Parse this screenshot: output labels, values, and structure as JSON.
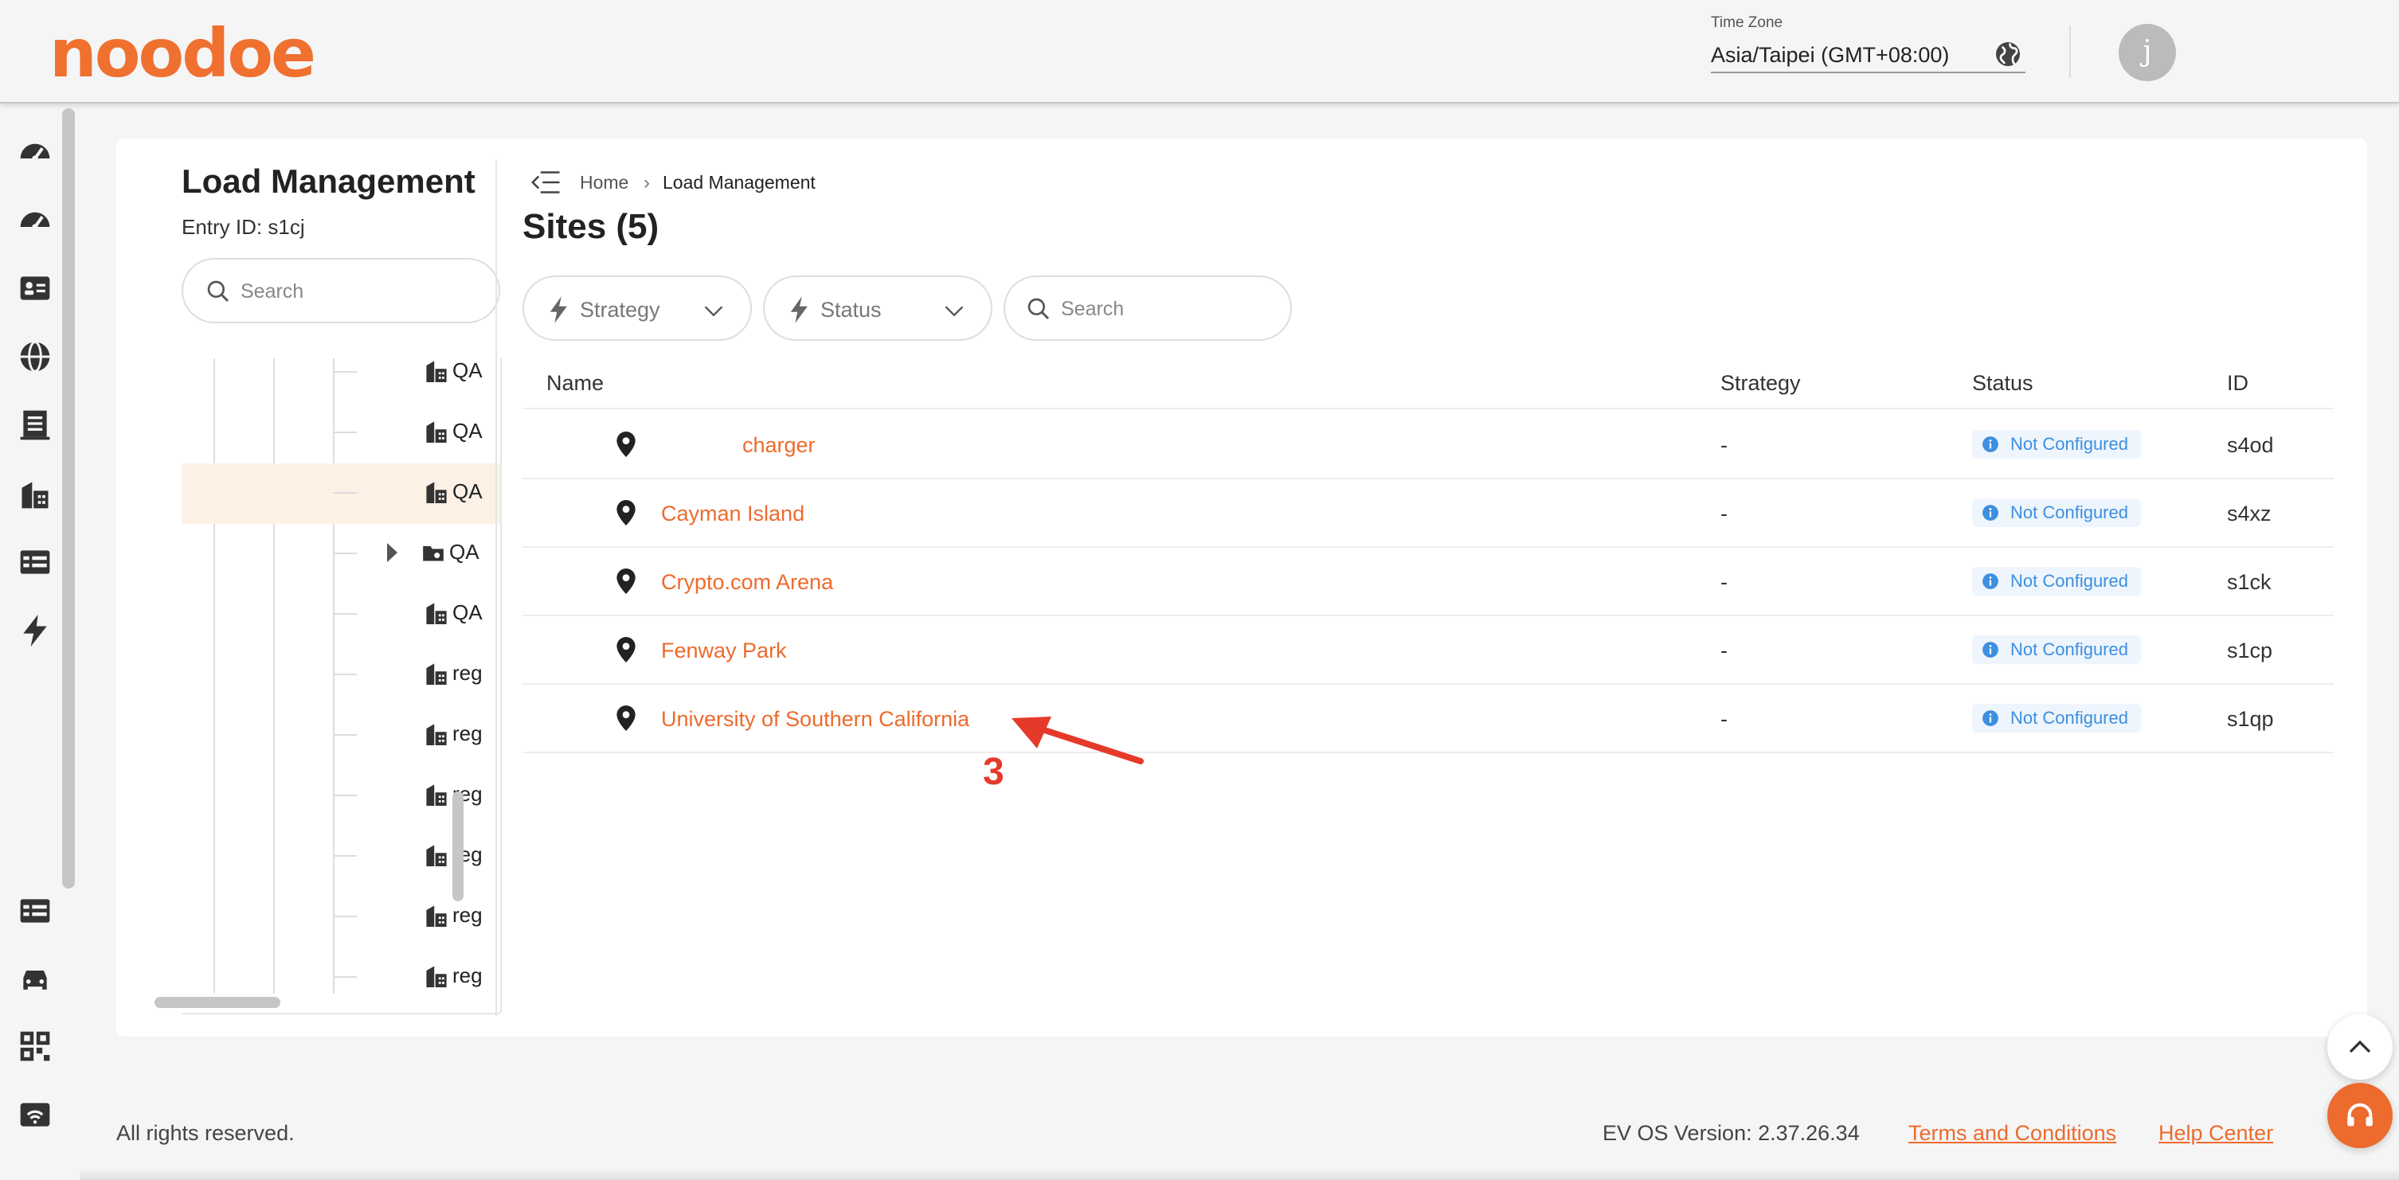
{
  "header": {
    "logo": "noodoe",
    "timezone_label": "Time Zone",
    "timezone_value": "Asia/Taipei (GMT+08:00)",
    "avatar_initial": "j"
  },
  "rail": {
    "icons": [
      "dashboard-icon",
      "dashboard-alt-icon",
      "id-card-icon",
      "globe-icon",
      "building-icon",
      "city-icon",
      "table-icon",
      "bolt-icon",
      "table-alt-icon",
      "car-icon",
      "qr-code-icon",
      "wifi-card-icon"
    ]
  },
  "tree": {
    "title": "Load Management",
    "entry_id": "Entry ID: s1cj",
    "search_placeholder": "Search",
    "items": [
      {
        "label": "QA"
      },
      {
        "label": "QA"
      },
      {
        "label": "QA",
        "selected": true
      },
      {
        "label": "QA",
        "expandable": true
      },
      {
        "label": "QA"
      },
      {
        "label": "reg"
      },
      {
        "label": "reg"
      },
      {
        "label": "reg"
      },
      {
        "label": "reg"
      },
      {
        "label": "reg"
      },
      {
        "label": "reg"
      }
    ]
  },
  "breadcrumb": {
    "home": "Home",
    "current": "Load Management"
  },
  "page_title": "Sites (5)",
  "filters": {
    "strategy_label": "Strategy",
    "status_label": "Status",
    "search_placeholder": "Search"
  },
  "table": {
    "columns": {
      "name": "Name",
      "strategy": "Strategy",
      "status": "Status",
      "id": "ID"
    },
    "rows": [
      {
        "name": "charger",
        "strategy": "-",
        "status": "Not Configured",
        "id": "s4od"
      },
      {
        "name": "Cayman Island",
        "strategy": "-",
        "status": "Not Configured",
        "id": "s4xz"
      },
      {
        "name": "Crypto.com Arena",
        "strategy": "-",
        "status": "Not Configured",
        "id": "s1ck"
      },
      {
        "name": "Fenway Park",
        "strategy": "-",
        "status": "Not Configured",
        "id": "s1cp"
      },
      {
        "name": "University of Southern California",
        "strategy": "-",
        "status": "Not Configured",
        "id": "s1qp"
      }
    ]
  },
  "annotation": {
    "number": "3",
    "color": "#e53a2a"
  },
  "footer": {
    "rights": "All rights reserved.",
    "version": "EV OS Version: 2.37.26.34",
    "terms": "Terms and Conditions",
    "help": "Help Center"
  },
  "colors": {
    "brand": "#ec6b2d",
    "status_blue": "#3d8fe0",
    "selected_row": "#fdf1e6"
  }
}
